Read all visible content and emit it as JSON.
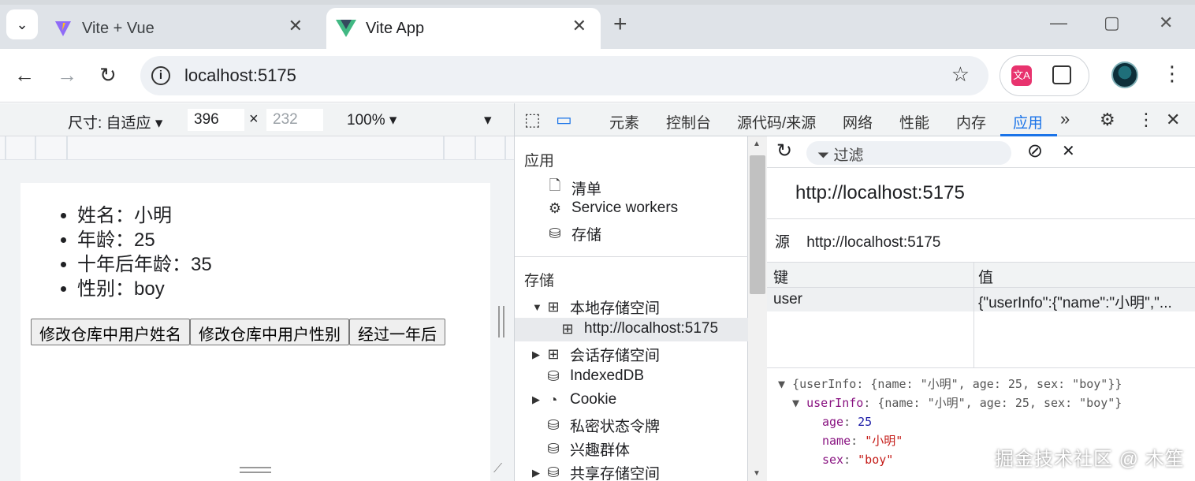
{
  "browser": {
    "tabs": [
      {
        "title": "Vite + Vue",
        "active": false,
        "icon": "vite-icon"
      },
      {
        "title": "Vite App",
        "active": true,
        "icon": "vue-icon"
      }
    ],
    "new_tab": "+",
    "address": "localhost:5175",
    "window_controls": {
      "minimize": "—",
      "maximize": "▢",
      "close": "✕"
    }
  },
  "device_toolbar": {
    "dimensions_label": "尺寸: 自适应 ▾",
    "width": "396",
    "height_placeholder": "232",
    "times": "×",
    "zoom": "100% ▾",
    "more": "▾"
  },
  "page": {
    "items": [
      "姓名：小明",
      "年龄：25",
      "十年后年龄：35",
      "性别：boy"
    ],
    "buttons": [
      "修改仓库中用户姓名",
      "修改仓库中用户性别",
      "经过一年后"
    ]
  },
  "devtools": {
    "tabs": [
      "元素",
      "控制台",
      "源代码/来源",
      "网络",
      "性能",
      "内存",
      "应用"
    ],
    "active_tab": "应用",
    "more_tabs": "»",
    "sidebar": {
      "section_app": "应用",
      "app_items": [
        "清单",
        "Service workers",
        "存储"
      ],
      "section_storage": "存储",
      "storage_items": [
        "本地存储空间",
        "http://localhost:5175",
        "会话存储空间",
        "IndexedDB",
        "Cookie",
        "私密状态令牌",
        "兴趣群体",
        "共享存储空间"
      ]
    },
    "filter_placeholder": "过滤",
    "origin_title": "http://localhost:5175",
    "origin_label": "源",
    "origin_value": "http://localhost:5175",
    "table": {
      "headers": [
        "键",
        "值"
      ],
      "rows": [
        {
          "key": "user",
          "value": "{\"userInfo\":{\"name\":\"小明\",\"..."
        }
      ]
    },
    "preview": {
      "line1": "{userInfo: {name: \"小明\", age: 25, sex: \"boy\"}}",
      "line2_key": "userInfo",
      "line2_value": ": {name: \"小明\", age: 25, sex: \"boy\"}",
      "age_key": "age",
      "age_value": "25",
      "name_key": "name",
      "name_value": "\"小明\"",
      "sex_key": "sex",
      "sex_value": "\"boy\""
    }
  },
  "watermark": "掘金技术社区 @ 木笙",
  "colors": {
    "accent": "#1a73e8",
    "tabstrip": "#dfe3e8"
  }
}
